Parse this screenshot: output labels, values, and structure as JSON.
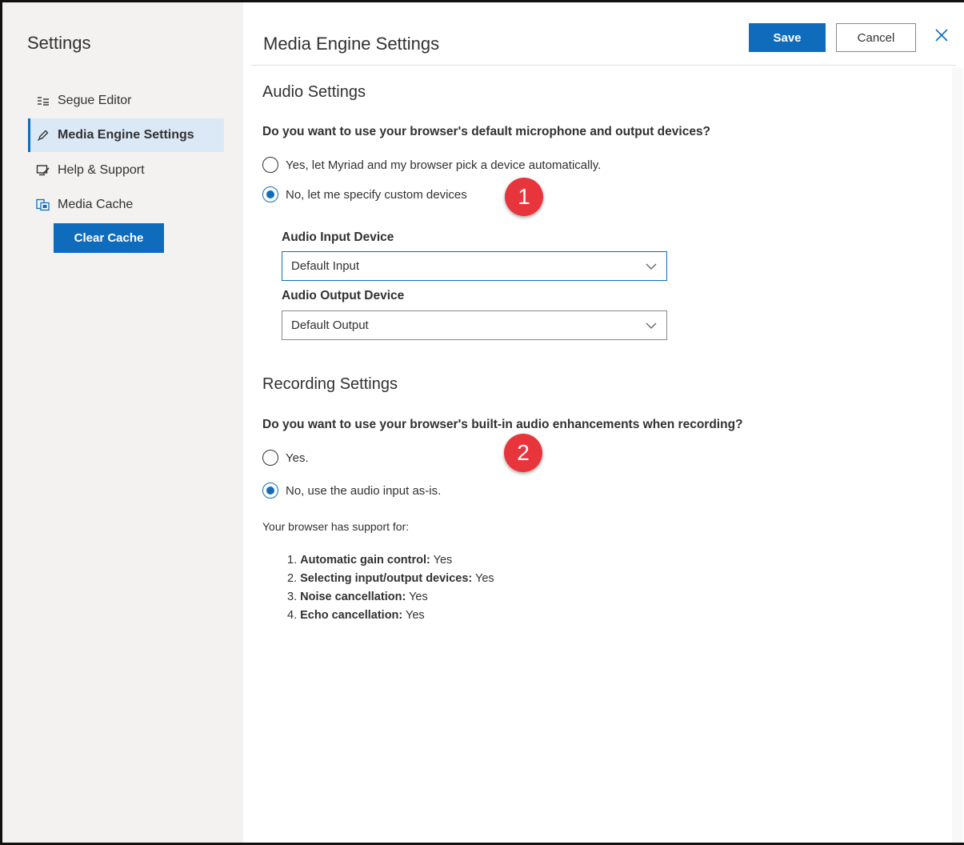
{
  "sidebar": {
    "title": "Settings",
    "items": [
      {
        "label": "Segue Editor",
        "icon": "segue-editor-icon",
        "active": false
      },
      {
        "label": "Media Engine Settings",
        "icon": "pen-icon",
        "active": true
      },
      {
        "label": "Help & Support",
        "icon": "help-support-icon",
        "active": false
      },
      {
        "label": "Media Cache",
        "icon": "media-cache-icon",
        "active": false
      }
    ],
    "clear_cache_label": "Clear Cache"
  },
  "header": {
    "title": "Media Engine Settings",
    "save_label": "Save",
    "cancel_label": "Cancel"
  },
  "audio": {
    "section_title": "Audio Settings",
    "question": "Do you want to use your browser's default microphone and output devices?",
    "options": [
      {
        "label": "Yes, let Myriad and my browser pick a device automatically.",
        "checked": false
      },
      {
        "label": "No, let me specify custom devices",
        "checked": true
      }
    ],
    "input_label": "Audio Input Device",
    "input_value": "Default Input",
    "output_label": "Audio Output Device",
    "output_value": "Default Output"
  },
  "recording": {
    "section_title": "Recording Settings",
    "question": "Do you want to use your browser's built-in audio enhancements when recording?",
    "options": [
      {
        "label": "Yes.",
        "checked": false
      },
      {
        "label": "No, use the audio input as-is.",
        "checked": true
      }
    ],
    "support_intro": "Your browser has support for:",
    "support_items": [
      {
        "num": "1.",
        "name": "Automatic gain control:",
        "value": "Yes"
      },
      {
        "num": "2.",
        "name": "Selecting input/output devices:",
        "value": "Yes"
      },
      {
        "num": "3.",
        "name": "Noise cancellation:",
        "value": "Yes"
      },
      {
        "num": "4.",
        "name": "Echo cancellation:",
        "value": "Yes"
      }
    ]
  },
  "annotations": {
    "badge_1": "1",
    "badge_2": "2"
  },
  "colors": {
    "accent": "#0f6cbd",
    "sidebar_bg": "#f3f2f1",
    "active_item_bg": "#dbe9f7",
    "badge": "#e8353b"
  }
}
